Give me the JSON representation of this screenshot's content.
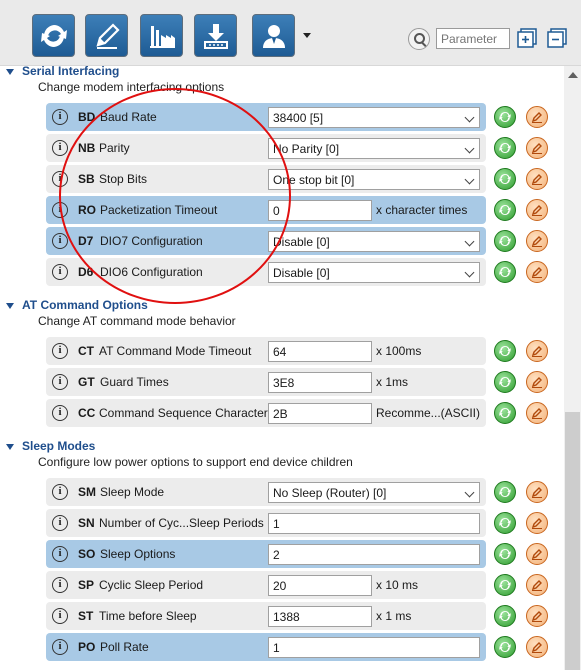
{
  "toolbar": {
    "buttons": [
      {
        "name": "refresh-button",
        "icon": "refresh-icon"
      },
      {
        "name": "edit-button",
        "icon": "pencil-icon"
      },
      {
        "name": "factory-button",
        "icon": "factory-icon"
      },
      {
        "name": "download-button",
        "icon": "download-icon"
      },
      {
        "name": "profile-button",
        "icon": "user-icon"
      }
    ],
    "search_placeholder": "Parameter"
  },
  "sections": [
    {
      "title": "Serial Interfacing",
      "description": "Change modem interfacing options",
      "rows": [
        {
          "code": "BD",
          "name": "Baud Rate",
          "value": "38400 [5]",
          "type": "select",
          "selected": true
        },
        {
          "code": "NB",
          "name": "Parity",
          "value": "No Parity [0]",
          "type": "select",
          "selected": false
        },
        {
          "code": "SB",
          "name": "Stop Bits",
          "value": "One stop bit [0]",
          "type": "select",
          "selected": false
        },
        {
          "code": "RO",
          "name": "Packetization Timeout",
          "value": "0",
          "unit": "x character times",
          "type": "text",
          "selected": true
        },
        {
          "code": "D7",
          "name": "DIO7 Configuration",
          "value": "Disable [0]",
          "type": "select",
          "selected": true
        },
        {
          "code": "D6",
          "name": "DIO6 Configuration",
          "value": "Disable [0]",
          "type": "select",
          "selected": false
        }
      ]
    },
    {
      "title": "AT Command Options",
      "description": "Change AT command mode behavior",
      "rows": [
        {
          "code": "CT",
          "name": "AT Command Mode Timeout",
          "value": "64",
          "unit": "x 100ms",
          "type": "text",
          "selected": false
        },
        {
          "code": "GT",
          "name": "Guard Times",
          "value": "3E8",
          "unit": "x 1ms",
          "type": "text",
          "selected": false
        },
        {
          "code": "CC",
          "name": "Command Sequence Character",
          "value": "2B",
          "unit": "Recomme...(ASCII)",
          "type": "text",
          "selected": false
        }
      ]
    },
    {
      "title": "Sleep Modes",
      "description": "Configure low power options to support end device children",
      "rows": [
        {
          "code": "SM",
          "name": "Sleep Mode",
          "value": "No Sleep (Router) [0]",
          "type": "select",
          "selected": false
        },
        {
          "code": "SN",
          "name": "Number of Cyc...Sleep Periods",
          "value": "1",
          "type": "text-wide",
          "selected": false
        },
        {
          "code": "SO",
          "name": "Sleep Options",
          "value": "2",
          "type": "text-wide",
          "selected": true
        },
        {
          "code": "SP",
          "name": "Cyclic Sleep Period",
          "value": "20",
          "unit": "x 10 ms",
          "type": "text",
          "selected": false
        },
        {
          "code": "ST",
          "name": "Time before Sleep",
          "value": "1388",
          "unit": "x 1 ms",
          "type": "text",
          "selected": false
        },
        {
          "code": "PO",
          "name": "Poll Rate",
          "value": "1",
          "type": "text-wide",
          "selected": true
        }
      ]
    }
  ],
  "colors": {
    "accent": "#1f4e8c",
    "row_selected": "#a8c9e5",
    "row": "#ececec",
    "annotation": "#e01010"
  }
}
